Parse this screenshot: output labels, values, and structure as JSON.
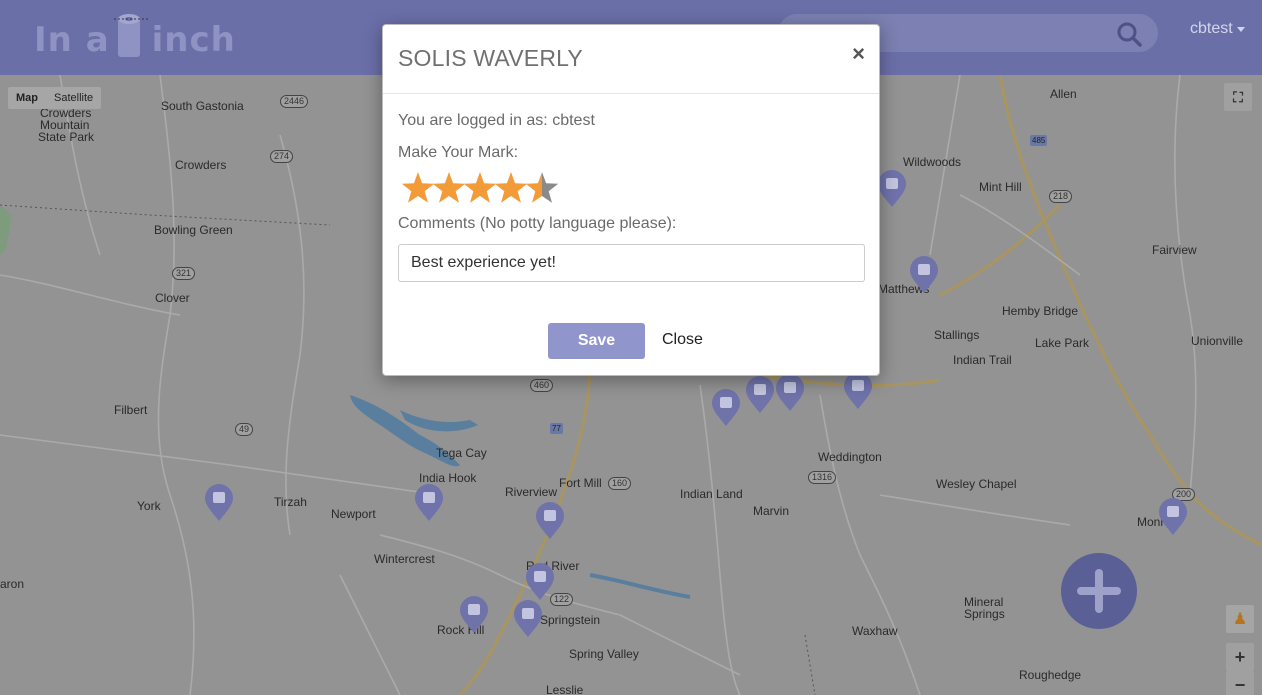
{
  "header": {
    "logo_left": "In a",
    "logo_right": "inch",
    "user": "cbtest"
  },
  "map": {
    "type_controls": [
      "Map",
      "Satellite"
    ],
    "places": [
      {
        "name": "South Gastonia"
      },
      {
        "name": "Crowders"
      },
      {
        "name": "Crowders"
      },
      {
        "name": "Mountain"
      },
      {
        "name": "State Park"
      },
      {
        "name": "Bowling Green"
      },
      {
        "name": "Clover"
      },
      {
        "name": "Filbert"
      },
      {
        "name": "York"
      },
      {
        "name": "Tirzah"
      },
      {
        "name": "Newport"
      },
      {
        "name": "India Hook"
      },
      {
        "name": "Tega Cay"
      },
      {
        "name": "Riverview"
      },
      {
        "name": "Fort Mill"
      },
      {
        "name": "Wintercrest"
      },
      {
        "name": "Red River"
      },
      {
        "name": "Rock Hill"
      },
      {
        "name": "Springstein"
      },
      {
        "name": "Spring Valley"
      },
      {
        "name": "Lesslie"
      },
      {
        "name": "Indian Land"
      },
      {
        "name": "Marvin"
      },
      {
        "name": "Weddington"
      },
      {
        "name": "Wesley Chapel"
      },
      {
        "name": "Mineral"
      },
      {
        "name": "Springs"
      },
      {
        "name": "Waxhaw"
      },
      {
        "name": "Roughedge"
      },
      {
        "name": "Allen"
      },
      {
        "name": "Wildwoods"
      },
      {
        "name": "Mint Hill"
      },
      {
        "name": "Matthews"
      },
      {
        "name": "Fairview"
      },
      {
        "name": "Hemby Bridge"
      },
      {
        "name": "Stallings"
      },
      {
        "name": "Lake Park"
      },
      {
        "name": "Indian Trail"
      },
      {
        "name": "Unionville"
      },
      {
        "name": "Monr"
      },
      {
        "name": "aron"
      }
    ],
    "zoom_in": "+",
    "zoom_out": "−"
  },
  "modal": {
    "title": "SOLIS WAVERLY",
    "close_x": "×",
    "logged_in": "You are logged in as: cbtest",
    "mark_label": "Make Your Mark:",
    "rating": 4.5,
    "rating_max": 5,
    "comments_label": "Comments (No potty language please):",
    "comment_value": "Best experience yet!",
    "save_label": "Save",
    "close_label": "Close"
  },
  "colors": {
    "header": "#6b6fa8",
    "star": "#f29b38",
    "save": "#9095cc"
  }
}
